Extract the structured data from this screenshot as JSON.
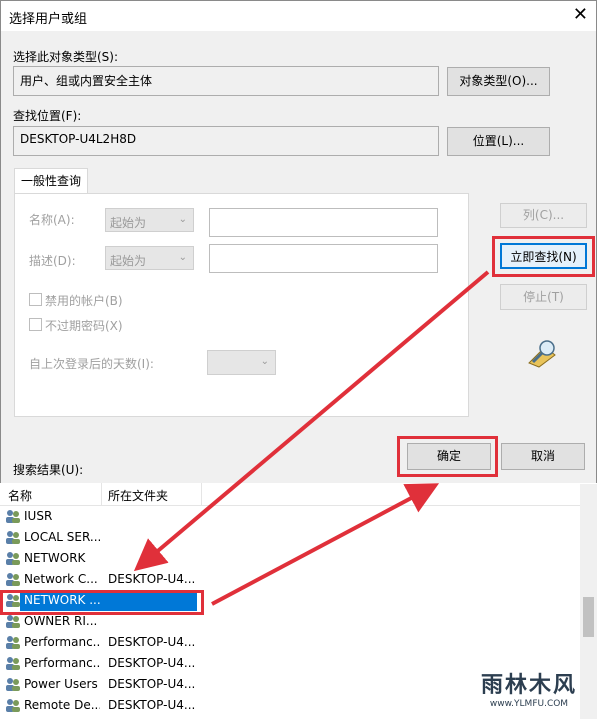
{
  "window": {
    "title": "选择用户或组",
    "close": "✕"
  },
  "object_types": {
    "label": "选择此对象类型(S):",
    "value": "用户、组或内置安全主体",
    "button": "对象类型(O)..."
  },
  "location": {
    "label": "查找位置(F):",
    "value": "DESKTOP-U4L2H8D",
    "button": "位置(L)..."
  },
  "query": {
    "tab": "一般性查询",
    "name_label": "名称(A):",
    "name_mode": "起始为",
    "desc_label": "描述(D):",
    "desc_mode": "起始为",
    "disabled_accounts": "禁用的帐户(B)",
    "no_expire_pwd": "不过期密码(X)",
    "days_label": "自上次登录后的天数(I):"
  },
  "buttons": {
    "columns": "列(C)...",
    "find_now": "立即查找(N)",
    "stop": "停止(T)",
    "ok": "确定",
    "cancel": "取消"
  },
  "results": {
    "label": "搜索结果(U):",
    "columns": [
      "名称",
      "所在文件夹"
    ],
    "rows": [
      {
        "name": "IUSR",
        "folder": ""
      },
      {
        "name": "LOCAL SER...",
        "folder": ""
      },
      {
        "name": "NETWORK",
        "folder": ""
      },
      {
        "name": "Network C...",
        "folder": "DESKTOP-U4..."
      },
      {
        "name": "NETWORK ...",
        "folder": ""
      },
      {
        "name": "OWNER RI...",
        "folder": ""
      },
      {
        "name": "Performanc...",
        "folder": "DESKTOP-U4..."
      },
      {
        "name": "Performanc...",
        "folder": "DESKTOP-U4..."
      },
      {
        "name": "Power Users",
        "folder": "DESKTOP-U4..."
      },
      {
        "name": "Remote De...",
        "folder": "DESKTOP-U4..."
      }
    ]
  },
  "watermark": {
    "brand": "雨林木风",
    "url": "www.YLMFU.COM"
  },
  "colors": {
    "accent": "#0078d7",
    "annotation": "#e0303a"
  }
}
